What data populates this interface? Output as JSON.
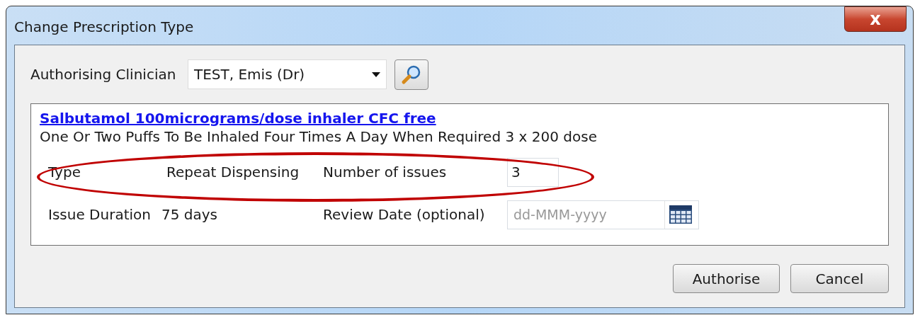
{
  "window": {
    "title": "Change Prescription Type",
    "close": "x"
  },
  "clinician": {
    "label": "Authorising Clinician",
    "value": "TEST, Emis (Dr)"
  },
  "drug": {
    "name": "Salbutamol 100micrograms/dose inhaler CFC free",
    "instructions": "One Or Two Puffs To Be Inhaled Four Times A Day When Required  3 x 200 dose"
  },
  "type_row": {
    "label": "Type",
    "value": "Repeat Dispensing",
    "issues_label": "Number of issues",
    "issues_value": "3",
    "highlighted": true
  },
  "duration_row": {
    "label": "Issue Duration",
    "value": "75 days",
    "review_label": "Review Date (optional)",
    "review_placeholder": "dd-MMM-yyyy"
  },
  "buttons": [
    {
      "label": "Authorise"
    },
    {
      "label": "Cancel"
    }
  ]
}
